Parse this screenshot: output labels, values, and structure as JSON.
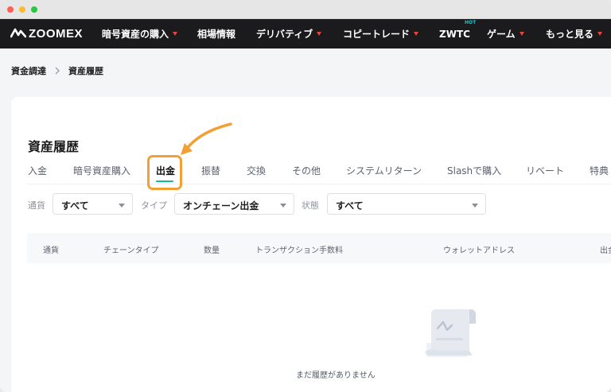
{
  "logo": {
    "text": "ZOOMEX"
  },
  "nav": {
    "items": [
      {
        "label": "暗号資産の購入",
        "caret": true
      },
      {
        "label": "相場情報",
        "caret": false
      },
      {
        "label": "デリバティブ",
        "caret": true
      },
      {
        "label": "コピートレード",
        "caret": true
      },
      {
        "label": "ZWTC",
        "caret": false,
        "badge": "HOT"
      },
      {
        "label": "ゲーム",
        "caret": true
      },
      {
        "label": "もっと見る",
        "caret": true
      }
    ]
  },
  "breadcrumb": {
    "parent": "資金調達",
    "current": "資産履歴"
  },
  "page": {
    "title": "資産履歴"
  },
  "tabs": [
    {
      "label": "入金",
      "active": false
    },
    {
      "label": "暗号資産購入",
      "active": false
    },
    {
      "label": "出金",
      "active": true
    },
    {
      "label": "振替",
      "active": false
    },
    {
      "label": "交換",
      "active": false
    },
    {
      "label": "その他",
      "active": false
    },
    {
      "label": "システムリターン",
      "active": false
    },
    {
      "label": "Slashで購入",
      "active": false
    },
    {
      "label": "リベート",
      "active": false
    },
    {
      "label": "特典",
      "active": false
    }
  ],
  "filters": {
    "currency": {
      "label": "通貨",
      "value": "すべて"
    },
    "type": {
      "label": "タイプ",
      "value": "オンチェーン出金"
    },
    "status": {
      "label": "状態",
      "value": "すべて"
    }
  },
  "table": {
    "columns": [
      "通貨",
      "チェーンタイプ",
      "数量",
      "トランザクション手数料",
      "ウォレットアドレス",
      "出金"
    ]
  },
  "empty": {
    "text": "まだ履歴がありません"
  },
  "colors": {
    "accent": "#14b8a6",
    "highlight": "#f2a036",
    "nav_bg": "#1b1b1e",
    "caret": "#e8453c"
  }
}
